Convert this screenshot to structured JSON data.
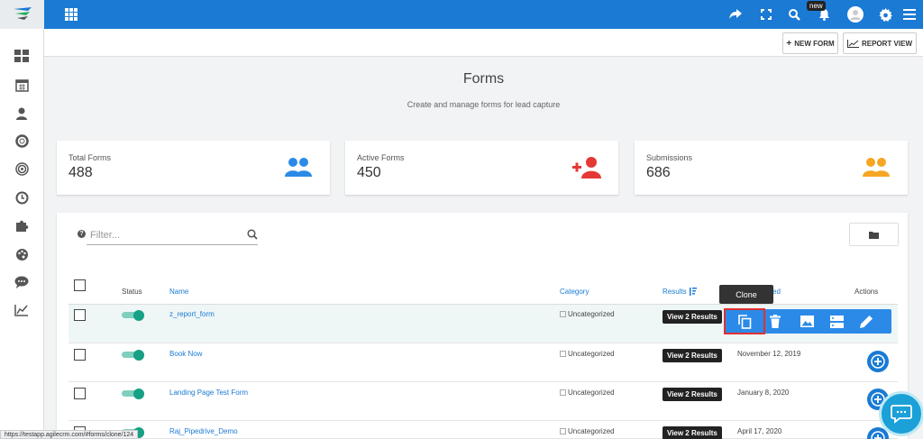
{
  "topbar": {
    "badge": "new",
    "colors": {
      "bar": "#1a7ad4"
    }
  },
  "toolbar": {
    "new_form_label": "NEW FORM",
    "report_view_label": "REPORT VIEW"
  },
  "page": {
    "title": "Forms",
    "subtitle": "Create and manage forms for lead capture"
  },
  "cards": [
    {
      "label": "Total Forms",
      "value": "488",
      "icon": "users-icon",
      "color": "#2b8ae8"
    },
    {
      "label": "Active Forms",
      "value": "450",
      "icon": "add-user-icon",
      "color": "#e53935"
    },
    {
      "label": "Submissions",
      "value": "686",
      "icon": "users-icon",
      "color": "#f5a623"
    }
  ],
  "filter": {
    "placeholder": "Filter..."
  },
  "table": {
    "headers": {
      "status": "Status",
      "name": "Name",
      "category": "Category",
      "results": "Results",
      "created": "ed",
      "actions": "Actions"
    },
    "rows": [
      {
        "name": "z_report_form",
        "category": "Uncategorized",
        "results": "View 2 Results",
        "date": ""
      },
      {
        "name": "Book Now",
        "category": "Uncategorized",
        "results": "View 2 Results",
        "date": "November 12, 2019"
      },
      {
        "name": "Landing Page Test Form",
        "category": "Uncategorized",
        "results": "View 2 Results",
        "date": "January 8, 2020"
      },
      {
        "name": "Raj_Pipedrive_Demo",
        "category": "Uncategorized",
        "results": "View 2 Results",
        "date": "April 17, 2020"
      }
    ]
  },
  "tooltip": "Clone",
  "row_actions": [
    "clone-icon",
    "trash-icon",
    "image-icon",
    "server-icon",
    "pencil-icon"
  ],
  "sidebar_icons": [
    "dashboard-icon",
    "calendar-icon",
    "user-icon",
    "lifebuoy-icon",
    "target-icon",
    "clock-icon",
    "puzzle-icon",
    "palette-icon",
    "chat-icon",
    "chart-icon"
  ],
  "statusbar": "https://testapp.agilecrm.com/#forms/clone/124"
}
